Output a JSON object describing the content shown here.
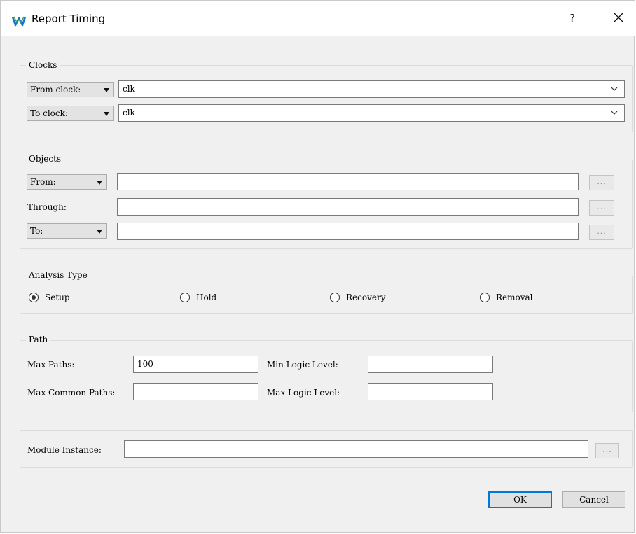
{
  "window": {
    "title": "Report Timing",
    "help_label": "?",
    "close_icon": "close-icon",
    "logo_icon": "app-logo-icon"
  },
  "clocks": {
    "group_title": "Clocks",
    "from_type": "From clock:",
    "from_value": "clk",
    "to_type": "To clock:",
    "to_value": "clk"
  },
  "objects": {
    "group_title": "Objects",
    "from_type": "From:",
    "through_label": "Through:",
    "to_type": "To:",
    "from_value": "",
    "through_value": "",
    "to_value": "",
    "browse_label": "..."
  },
  "analysis": {
    "group_title": "Analysis Type",
    "options": [
      "Setup",
      "Hold",
      "Recovery",
      "Removal"
    ],
    "selected": "Setup"
  },
  "path": {
    "group_title": "Path",
    "max_paths_label": "Max Paths:",
    "max_paths_value": "100",
    "max_common_label": "Max Common Paths:",
    "max_common_value": "",
    "min_logic_label": "Min Logic Level:",
    "min_logic_value": "",
    "max_logic_label": "Max Logic Level:",
    "max_logic_value": ""
  },
  "module": {
    "label": "Module Instance:",
    "value": "",
    "browse_label": "..."
  },
  "buttons": {
    "ok": "OK",
    "cancel": "Cancel"
  },
  "colors": {
    "dialog_bg": "#f0f0f0",
    "title_bg": "#ffffff",
    "default_button_border": "#0078d7",
    "logo_blue": "#1a73c9",
    "logo_green": "#3cab3a"
  }
}
